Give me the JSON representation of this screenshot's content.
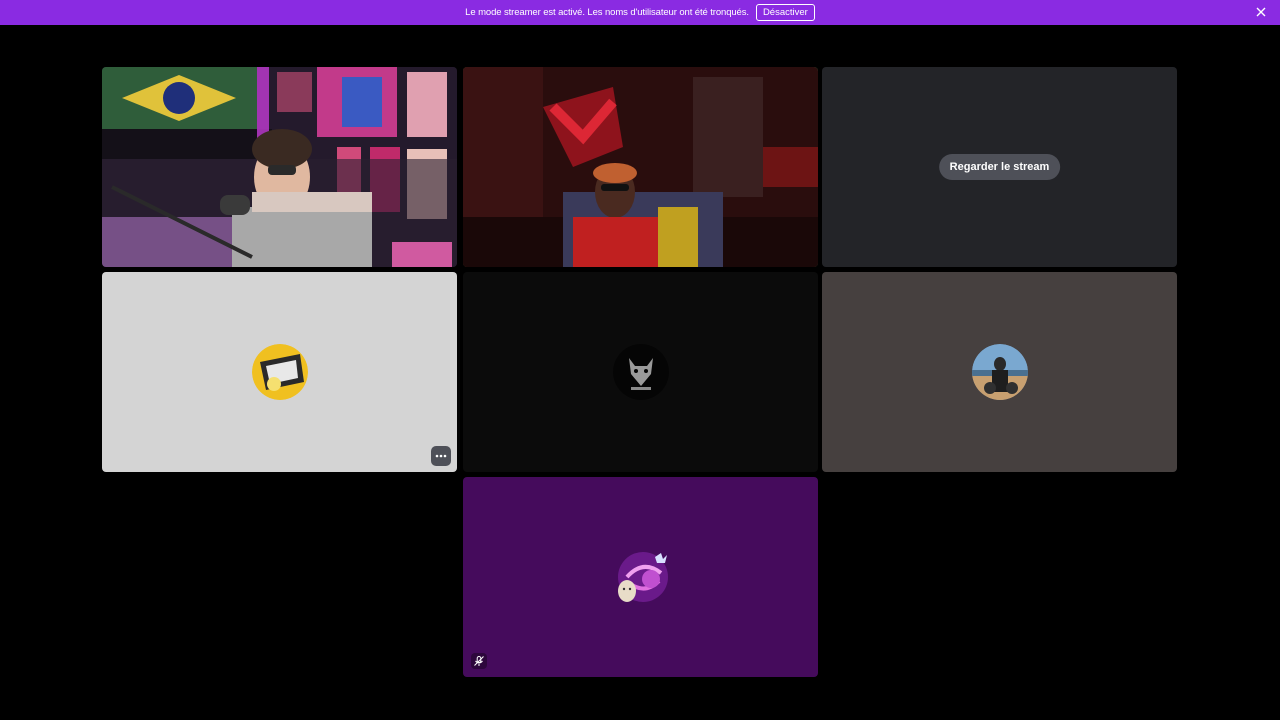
{
  "banner": {
    "message": "Le mode streamer est activé. Les noms d'utilisateur ont été tronqués.",
    "disable_label": "Désactiver",
    "close_icon": "close-icon",
    "background": "#8a2be2"
  },
  "tiles": [
    {
      "kind": "camera",
      "background": "#1a1420"
    },
    {
      "kind": "camera",
      "background": "#1c0a0a",
      "speaking": true
    },
    {
      "kind": "stream",
      "background": "#232428",
      "watch_label": "Regarder le stream"
    },
    {
      "kind": "avatar",
      "background": "#d4d4d4",
      "menu_icon": "more-icon"
    },
    {
      "kind": "avatar",
      "background": "#0b0b0b"
    },
    {
      "kind": "avatar",
      "background": "#46403f"
    },
    {
      "kind": "avatar",
      "background": "#450b5c",
      "mute_icon": "mic-muted-icon"
    }
  ],
  "colors": {
    "speaking_border": "#3ba55d",
    "button_gray": "#4e5058"
  }
}
